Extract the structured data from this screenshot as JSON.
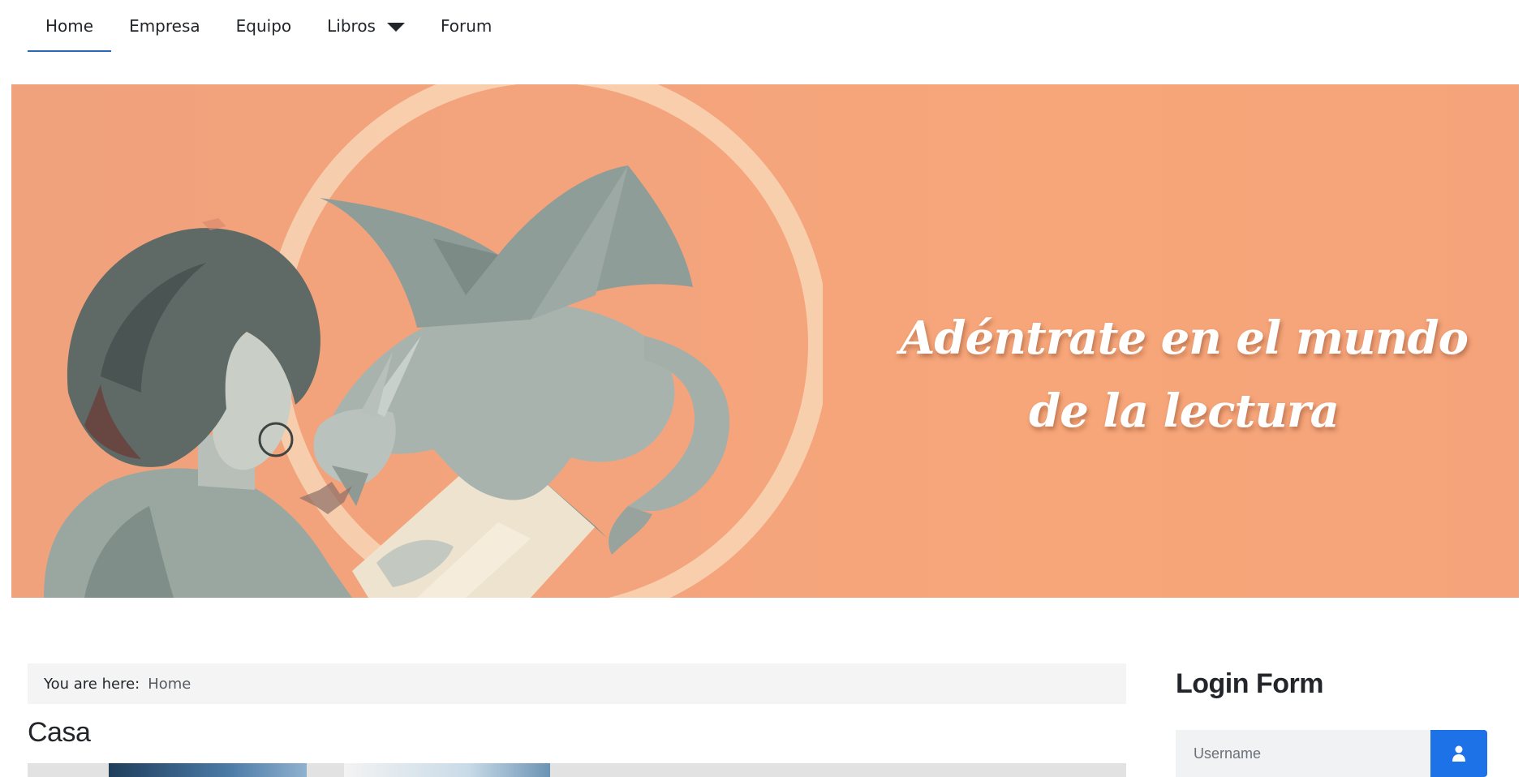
{
  "nav": {
    "items": [
      {
        "label": "Home"
      },
      {
        "label": "Empresa"
      },
      {
        "label": "Equipo"
      },
      {
        "label": "Libros"
      },
      {
        "label": "Forum"
      }
    ]
  },
  "banner": {
    "headline": "Adéntrate en el mundo de la lectura"
  },
  "breadcrumb": {
    "label": "You are here:",
    "current": "Home"
  },
  "main": {
    "title": "Casa"
  },
  "login": {
    "title": "Login Form",
    "username_placeholder": "Username",
    "user_icon": "user-icon"
  },
  "colors": {
    "accent": "#1e72e8",
    "nav_active_underline": "#2a69b8",
    "banner_bg": "#f4a47c"
  }
}
